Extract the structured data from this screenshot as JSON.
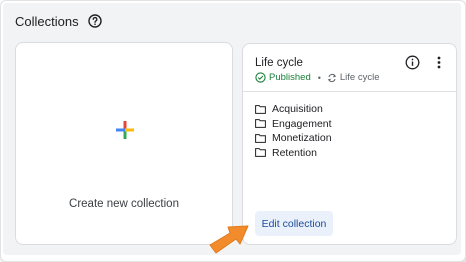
{
  "header": {
    "title": "Collections",
    "help_icon": "help-circle-icon"
  },
  "create_card": {
    "label": "Create new collection",
    "icon": "plus-icon"
  },
  "collection_card": {
    "title": "Life cycle",
    "status": "Published",
    "type": "Life cycle",
    "topics": [
      "Acquisition",
      "Engagement",
      "Monetization",
      "Retention"
    ],
    "edit_label": "Edit collection",
    "info_icon": "info-icon",
    "more_icon": "more-vert-icon"
  },
  "colors": {
    "panel_bg": "#f1f3f4",
    "published_green": "#188038",
    "edit_button_bg": "#eaf1fb",
    "edit_button_text": "#1a4d9e",
    "arrow_orange": "#f28b2b"
  }
}
